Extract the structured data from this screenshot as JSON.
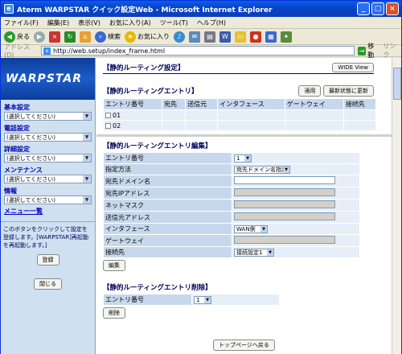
{
  "window": {
    "title": "Aterm WARPSTAR クイック設定Web - Microsoft Internet Explorer"
  },
  "menu": [
    "ファイル(F)",
    "編集(E)",
    "表示(V)",
    "お気に入り(A)",
    "ツール(T)",
    "ヘルプ(H)"
  ],
  "toolbar": {
    "back": "戻る",
    "search": "検索",
    "favorites": "お気に入り"
  },
  "address": {
    "label": "アドレス(D)",
    "url": "http://web.setup/index_frame.html",
    "go": "移動",
    "links": "リンク"
  },
  "sidebar": {
    "logo": "WARPSTAR",
    "sections": [
      {
        "heading": "基本設定",
        "select": "(選択してください)"
      },
      {
        "heading": "電話設定",
        "select": "(選択してください)"
      },
      {
        "heading": "詳細設定",
        "select": "(選択してください)"
      },
      {
        "heading": "メンテナンス",
        "select": "(選択してください)"
      },
      {
        "heading": "情報",
        "select": "(選択してください)"
      }
    ],
    "menu_link": "メニュー一覧",
    "note": "このボタンをクリックして設定を登録します。[WARPSTAR]再起動を再起動します。]",
    "register": "登録",
    "close": "閉じる"
  },
  "top": {
    "title": "【静的ルーティング設定】",
    "wide": "WIDE View",
    "entries_title": "【静的ルーティングエントリ】",
    "apply": "適用",
    "refresh": "最新状態に更新",
    "columns": [
      "エントリ番号",
      "宛先",
      "送信元",
      "インタフェース",
      "ゲートウェイ",
      "接続先"
    ],
    "rows": [
      "01",
      "02"
    ]
  },
  "edit": {
    "title": "【静的ルーティングエントリ編集】",
    "rows": [
      {
        "label": "エントリ番号",
        "value": "1"
      },
      {
        "label": "指定方法",
        "value": "宛先ドメイン名指定"
      },
      {
        "label": "宛先ドメイン名",
        "value": ""
      },
      {
        "label": "宛先IPアドレス",
        "value": ""
      },
      {
        "label": "ネットマスク",
        "value": ""
      },
      {
        "label": "送信元アドレス",
        "value": ""
      },
      {
        "label": "インタフェース",
        "value": "WAN側"
      },
      {
        "label": "ゲートウェイ",
        "value": ""
      },
      {
        "label": "接続先",
        "value": "接続設定1"
      }
    ],
    "button": "編集"
  },
  "delete": {
    "title": "【静的ルーティングエントリ削除】",
    "label": "エントリ番号",
    "value": "1",
    "button": "削除"
  },
  "top_page_button": "トップページへ戻る"
}
